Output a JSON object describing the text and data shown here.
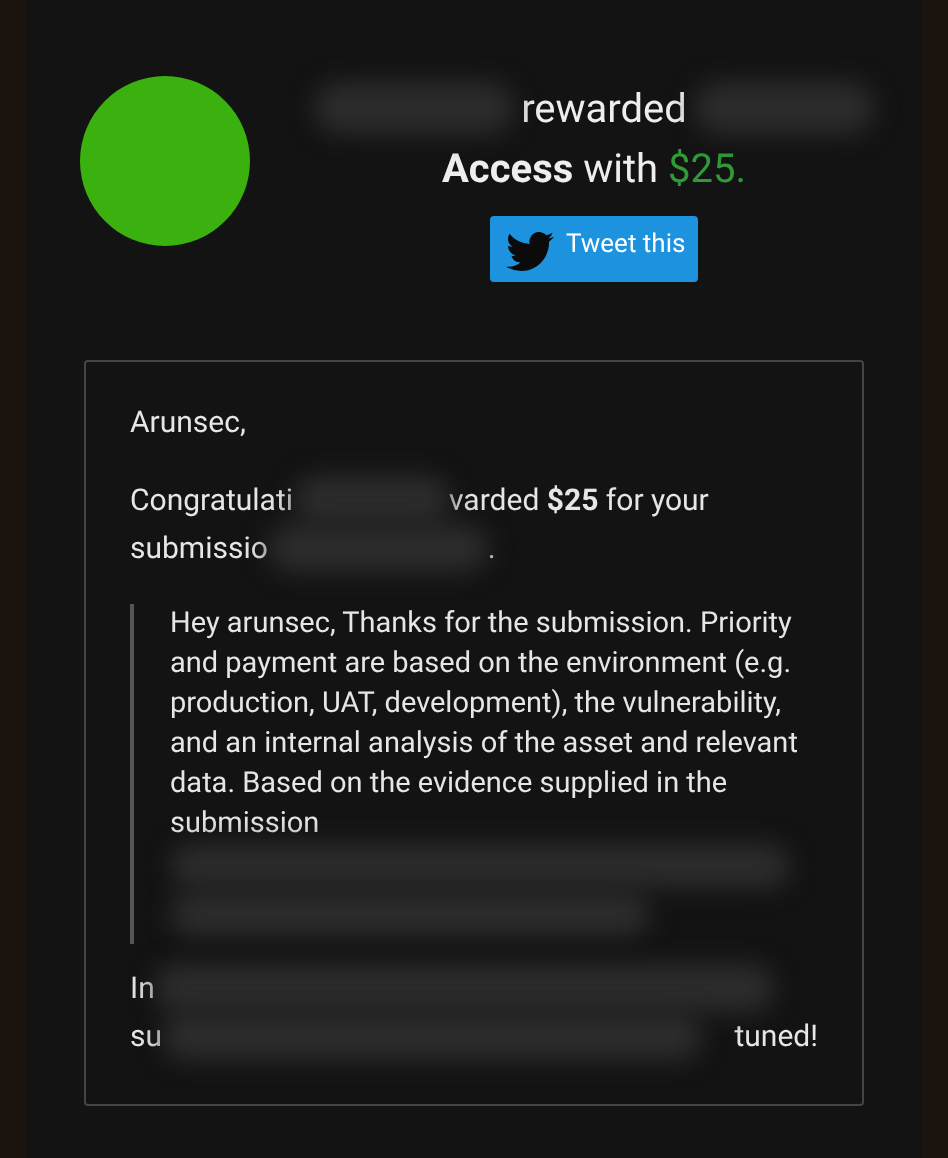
{
  "header": {
    "line_1": "rewarded",
    "line_2": "**Access** with",
    "amount": "$25.",
    "button": "Tweet this"
  },
  "email": {
    "greeting": "Arunsec,",
    "paragraph_1": {
      "line_1_start": "Congratulati",
      "line_1_end": "varded **$25** for your",
      "line_2_start": "submissio",
      "line_2_end": "."
    },
    "quote": {
      "text": "Hey arunsec, Thanks for the submission. Priority and payment are based on the environment (e.g. production, UAT, development), the vulnerability, and an internal analysis of the asset and relevant data. Based on the evidence supplied in the",
      "line_cut": "submission"
    },
    "closing": {
      "line_1_start": "In",
      "line_2_start": "su",
      "line_2_end": "tuned!"
    }
  }
}
